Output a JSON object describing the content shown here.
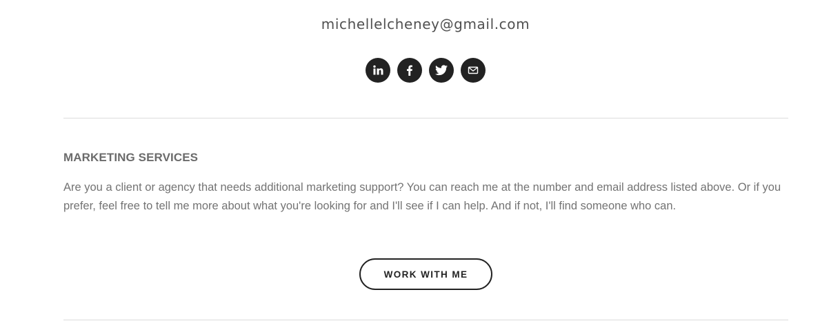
{
  "contact": {
    "email": "michellelcheney@gmail.com"
  },
  "social": [
    {
      "name": "linkedin",
      "icon": "linkedin-icon"
    },
    {
      "name": "facebook",
      "icon": "facebook-icon"
    },
    {
      "name": "twitter",
      "icon": "twitter-icon"
    },
    {
      "name": "email",
      "icon": "mail-icon"
    }
  ],
  "section": {
    "title": "MARKETING SERVICES",
    "body": "Are you a client or agency that needs additional marketing support? You can reach me at the number and email address listed above. Or if you prefer, feel free to tell me more about what you're looking for and I'll see if I can help. And if not, I'll find someone who can.",
    "cta_label": "WORK WITH ME"
  },
  "colors": {
    "icon_bg": "#222222",
    "text": "#737373",
    "divider": "#dcdcdc"
  }
}
